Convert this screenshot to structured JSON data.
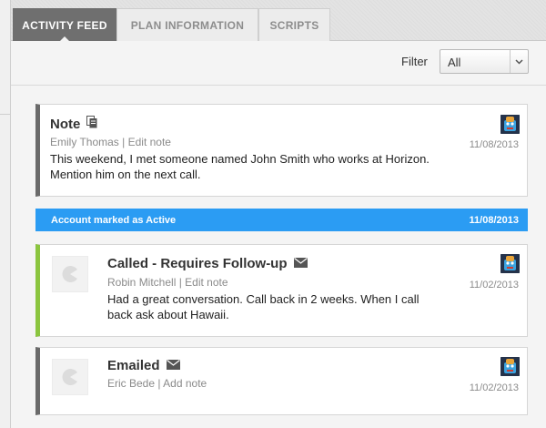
{
  "tabs": [
    {
      "label": "ACTIVITY FEED",
      "active": true
    },
    {
      "label": "PLAN INFORMATION",
      "active": false
    },
    {
      "label": "SCRIPTS",
      "active": false
    }
  ],
  "filter": {
    "label": "Filter",
    "selected": "All"
  },
  "feed": {
    "note": {
      "title": "Note",
      "icon": "document-icon",
      "author": "Emily Thomas",
      "action": "Edit note",
      "body": "This weekend, I met someone named John Smith who works at Horizon. Mention him on the next call.",
      "date": "11/08/2013"
    },
    "banner": {
      "text": "Account marked as Active",
      "date": "11/08/2013",
      "color": "#2b9cf3"
    },
    "called": {
      "title": "Called - Requires Follow-up",
      "icon": "envelope-icon",
      "author": "Robin Mitchell",
      "action": "Edit note",
      "body": "Had a great conversation. Call back in 2 weeks. When I call back ask about Hawaii.",
      "date": "11/02/2013",
      "accent": "#8bc53f"
    },
    "emailed": {
      "title": "Emailed",
      "icon": "envelope-icon",
      "author": "Eric Bede",
      "action": "Add note",
      "date": "11/02/2013"
    }
  },
  "separator": " | ",
  "colors": {
    "accent_gray": "#6a6a6a",
    "active_tab": "#6f6f6f"
  }
}
